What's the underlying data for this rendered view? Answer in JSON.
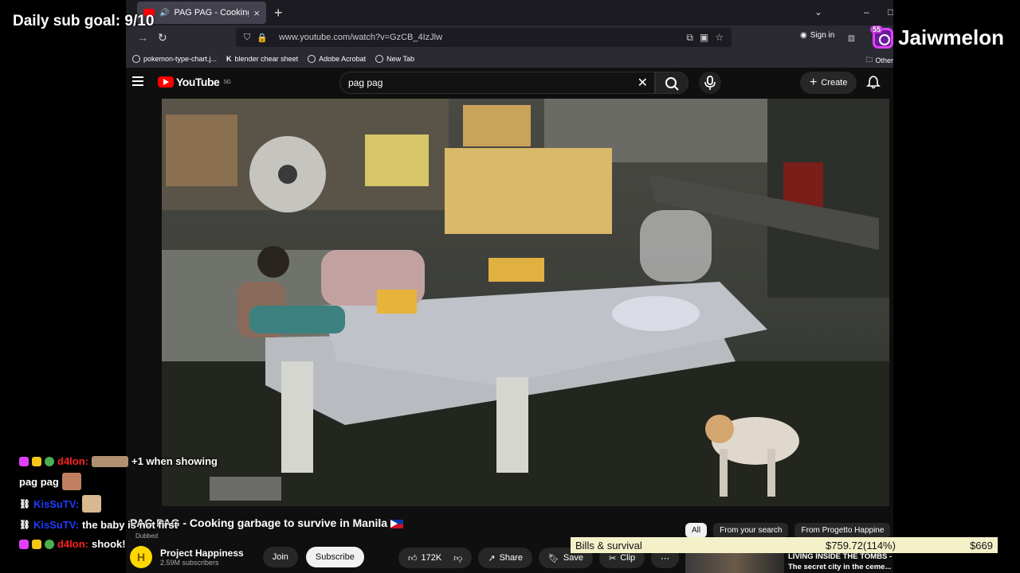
{
  "overlay": {
    "sub_goal": "Daily sub goal: 9/10",
    "streamer_name": "Jaiwmelon",
    "streamer_badge": "55"
  },
  "browser": {
    "tab_title": "PAG PAG - Cooking garbag",
    "url": "www.youtube.com/watch?v=GzCB_4IzJlw",
    "signin": "Sign in",
    "bookmarks": [
      "pokemon-type-chart.j...",
      "blender chear sheet",
      "Adobe Acrobat",
      "New Tab"
    ],
    "other_bookmarks": "Other"
  },
  "youtube": {
    "logo_text": "YouTube",
    "region": "SG",
    "search_value": "pag pag",
    "create_label": "Create",
    "video_title": "PAG PAG - Cooking garbage to survive in Manila",
    "dubbed": "Dubbed",
    "channel_name": "Project Happiness",
    "channel_subs": "2.59M subscribers",
    "join": "Join",
    "subscribe": "Subscribe",
    "likes": "172K",
    "share": "Share",
    "save": "Save",
    "clip": "Clip",
    "chips": [
      "All",
      "From your search",
      "From Progetto Happine"
    ],
    "rec_title_1": "LIVING INSIDE THE TOMBS -",
    "rec_title_2": "The secret city in the ceme..."
  },
  "chat": {
    "l1_user": "d4lon:",
    "l1_msg": "+1 when showing",
    "l2_msg": "pag pag",
    "l3_user": "KisSuTV:",
    "l4_user": "KisSuTV:",
    "l4_msg": "the baby is not first",
    "l5_user": "d4lon:",
    "l5_msg": "shook!"
  },
  "bills": {
    "label": "Bills & survival",
    "current": "$759.72(114%)",
    "goal": "$669"
  }
}
